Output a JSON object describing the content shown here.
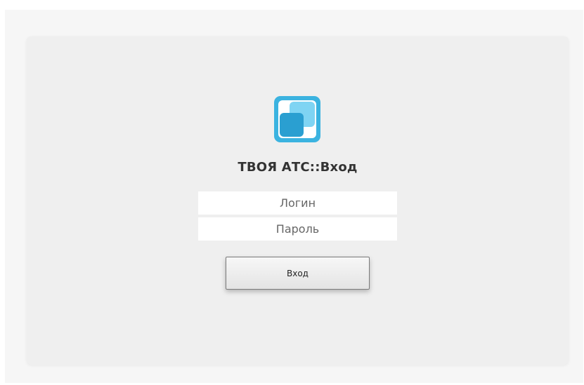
{
  "login_form": {
    "title": "ТВОЯ АТС::Вход",
    "login_placeholder": "Логин",
    "login_value": "",
    "password_placeholder": "Пароль",
    "password_value": "",
    "submit_label": "Вход"
  },
  "logo": {
    "icon": "two-squares-logo-icon",
    "colors": {
      "outer": "#3bb3e0",
      "light_square": "#7fd4f3",
      "dark_square": "#2a9fd1"
    }
  }
}
